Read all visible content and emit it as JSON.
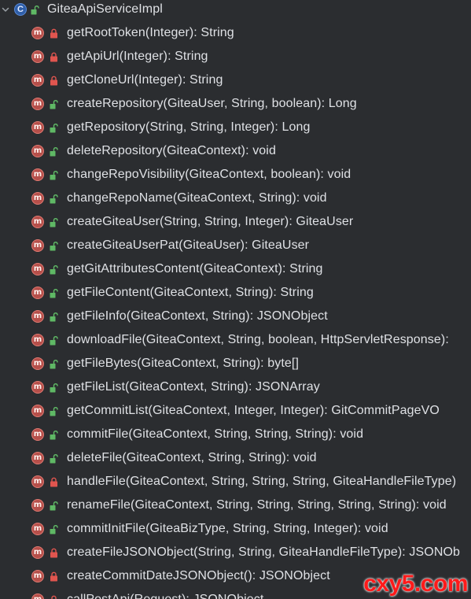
{
  "class_node": {
    "label": "GiteaApiServiceImpl",
    "icon": "class-icon",
    "visibility": "public",
    "expanded": true
  },
  "colors": {
    "background": "#2b2d30",
    "text": "#dfe1e5",
    "method_icon": "#b64f4a",
    "class_icon": "#2f5ea8",
    "public_lock": "#5fb865",
    "private_lock": "#e0554f",
    "watermark": "#ff1a1a"
  },
  "methods": [
    {
      "label": "getRootToken(Integer): String",
      "visibility": "private"
    },
    {
      "label": "getApiUrl(Integer): String",
      "visibility": "private"
    },
    {
      "label": "getCloneUrl(Integer): String",
      "visibility": "private"
    },
    {
      "label": "createRepository(GiteaUser, String, boolean): Long",
      "visibility": "public"
    },
    {
      "label": "getRepository(String, String, Integer): Long",
      "visibility": "public"
    },
    {
      "label": "deleteRepository(GiteaContext): void",
      "visibility": "public"
    },
    {
      "label": "changeRepoVisibility(GiteaContext, boolean): void",
      "visibility": "public"
    },
    {
      "label": "changeRepoName(GiteaContext, String): void",
      "visibility": "public"
    },
    {
      "label": "createGiteaUser(String, String, Integer): GiteaUser",
      "visibility": "public"
    },
    {
      "label": "createGiteaUserPat(GiteaUser): GiteaUser",
      "visibility": "public"
    },
    {
      "label": "getGitAttributesContent(GiteaContext): String",
      "visibility": "public"
    },
    {
      "label": "getFileContent(GiteaContext, String): String",
      "visibility": "public"
    },
    {
      "label": "getFileInfo(GiteaContext, String): JSONObject",
      "visibility": "public"
    },
    {
      "label": "downloadFile(GiteaContext, String, boolean, HttpServletResponse):",
      "visibility": "public"
    },
    {
      "label": "getFileBytes(GiteaContext, String): byte[]",
      "visibility": "public"
    },
    {
      "label": "getFileList(GiteaContext, String): JSONArray",
      "visibility": "public"
    },
    {
      "label": "getCommitList(GiteaContext, Integer, Integer): GitCommitPageVO",
      "visibility": "public"
    },
    {
      "label": "commitFile(GiteaContext, String, String, String): void",
      "visibility": "public"
    },
    {
      "label": "deleteFile(GiteaContext, String, String): void",
      "visibility": "public"
    },
    {
      "label": "handleFile(GiteaContext, String, String, String, GiteaHandleFileType)",
      "visibility": "private"
    },
    {
      "label": "renameFile(GiteaContext, String, String, String, String, String): void",
      "visibility": "public"
    },
    {
      "label": "commitInitFile(GiteaBizType, String, String, Integer): void",
      "visibility": "public"
    },
    {
      "label": "createFileJSONObject(String, String, GiteaHandleFileType): JSONOb",
      "visibility": "private"
    },
    {
      "label": "createCommitDateJSONObject(): JSONObject",
      "visibility": "private"
    },
    {
      "label": "callPostApi(Request): JSONObject",
      "visibility": "private"
    }
  ],
  "method_icon_glyph": "m",
  "class_icon_glyph": "C",
  "watermark": "cxy5.com"
}
